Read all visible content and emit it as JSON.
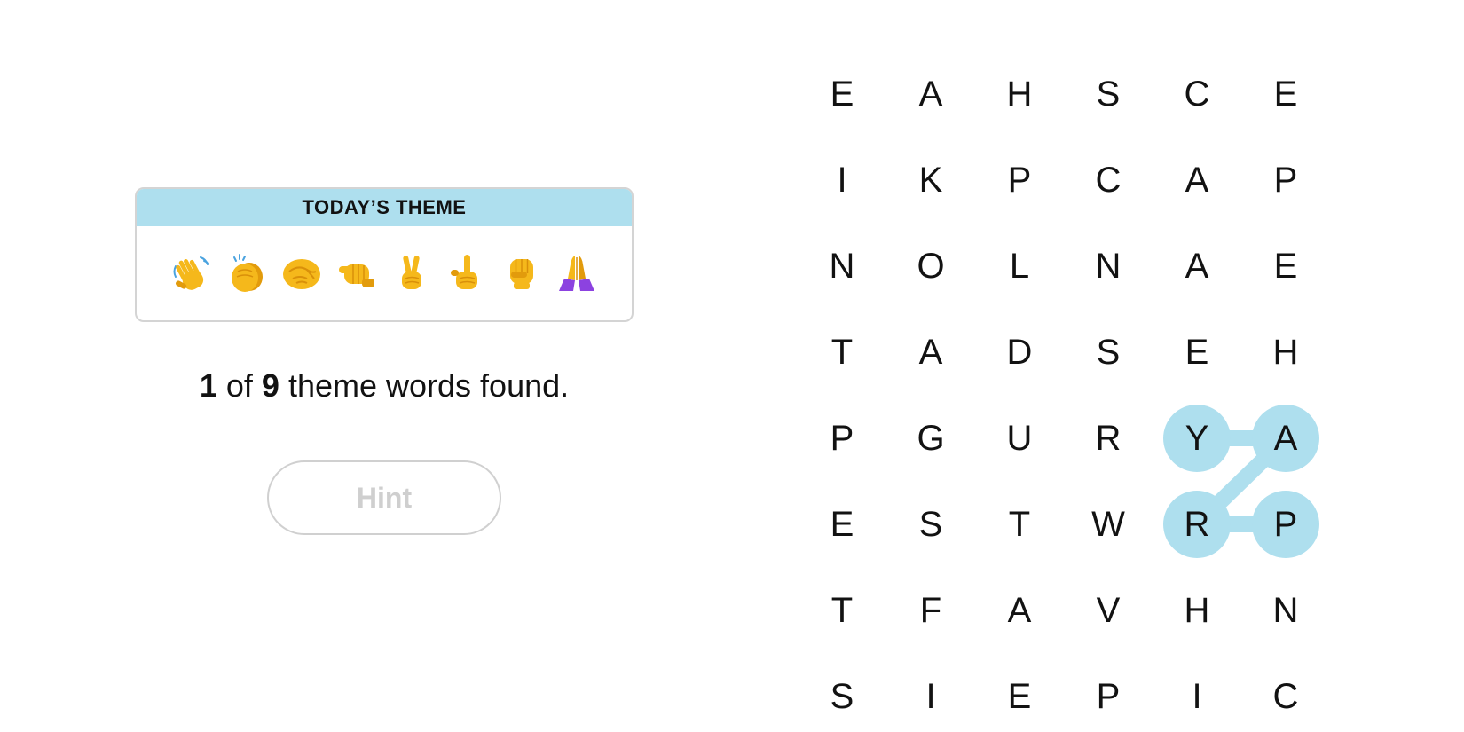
{
  "theme": {
    "header": "TODAY’S THEME",
    "emojis": [
      "waving-hand-icon",
      "clapping-hands-icon",
      "handshake-icon",
      "left-facing-fist-icon",
      "victory-hand-icon",
      "index-pointing-up-icon",
      "raised-fist-icon",
      "folded-hands-icon"
    ]
  },
  "progress": {
    "found": "1",
    "middle": " of ",
    "total": "9",
    "suffix": " theme words found."
  },
  "hint": {
    "label": "Hint",
    "enabled": false
  },
  "board": {
    "rows": [
      [
        "E",
        "A",
        "H",
        "S",
        "C",
        "E"
      ],
      [
        "I",
        "K",
        "P",
        "C",
        "A",
        "P"
      ],
      [
        "N",
        "O",
        "L",
        "N",
        "A",
        "E"
      ],
      [
        "T",
        "A",
        "D",
        "S",
        "E",
        "H"
      ],
      [
        "P",
        "G",
        "U",
        "R",
        "Y",
        "A"
      ],
      [
        "E",
        "S",
        "T",
        "W",
        "R",
        "P"
      ],
      [
        "T",
        "F",
        "A",
        "V",
        "H",
        "N"
      ],
      [
        "S",
        "I",
        "E",
        "P",
        "I",
        "C"
      ]
    ],
    "found_word": {
      "word": "PRAY",
      "path": [
        [
          5,
          5
        ],
        [
          5,
          4
        ],
        [
          4,
          5
        ],
        [
          4,
          4
        ]
      ]
    }
  },
  "colors": {
    "theme_header": "#aedfee",
    "found_highlight": "#aedfee",
    "skin": "#f5b81b",
    "sleeve": "#8c42e0",
    "hint_text": "#cfcfcf",
    "text": "#121212"
  }
}
